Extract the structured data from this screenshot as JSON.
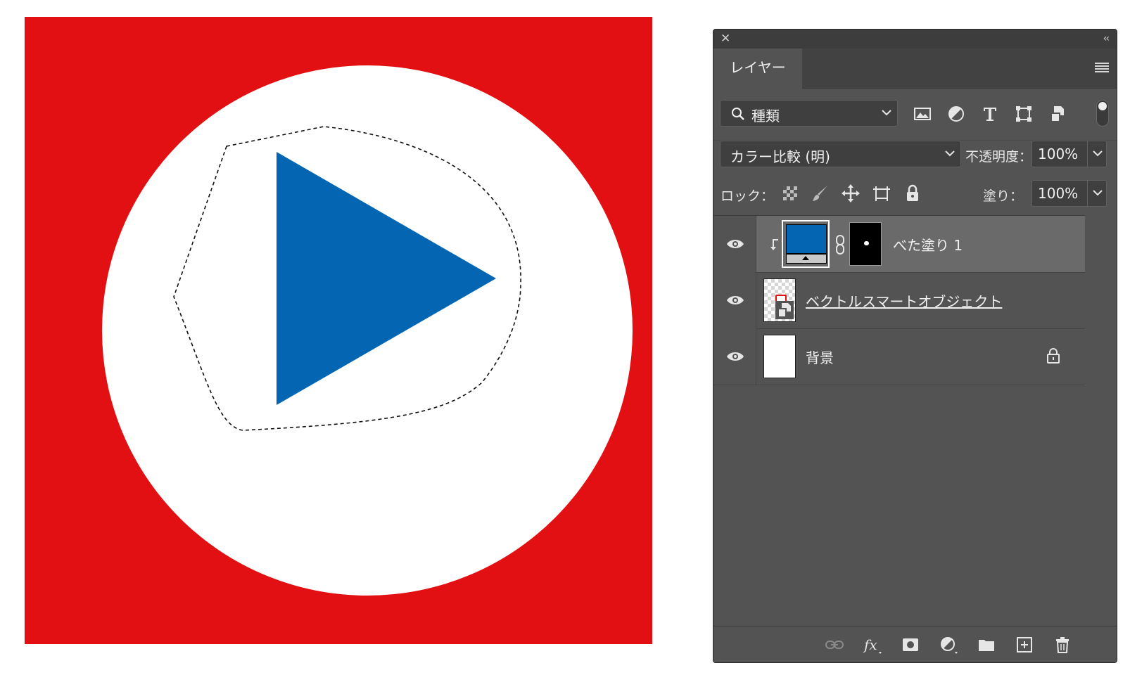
{
  "panel": {
    "tab_label": "レイヤー",
    "filter": {
      "label": "種類"
    },
    "blend": {
      "mode": "カラー比較 (明)",
      "opacity_label": "不透明度：",
      "opacity_value": "100%"
    },
    "lock": {
      "label": "ロック：",
      "fill_label": "塗り：",
      "fill_value": "100%"
    },
    "layers": [
      {
        "name": "べた塗り 1",
        "visible": true,
        "selected": true,
        "fill_color": "#0466b3"
      },
      {
        "name": "ベクトルスマートオブジェクト",
        "visible": true,
        "selected": false
      },
      {
        "name": "背景",
        "visible": true,
        "selected": false,
        "locked": true
      }
    ]
  },
  "canvas": {
    "background_color": "#e31013",
    "circle_color": "#ffffff",
    "triangle_color": "#0466b3"
  },
  "icons": {
    "close": "close-icon",
    "collapse": "collapse-icon",
    "menu": "panel-menu-icon",
    "filter": [
      "image-filter-icon",
      "adjustment-filter-icon",
      "type-filter-icon",
      "shape-filter-icon",
      "smart-object-filter-icon"
    ],
    "lock": [
      "lock-transparency-icon",
      "lock-pixels-icon",
      "lock-position-icon",
      "lock-artboard-icon",
      "lock-all-icon"
    ],
    "bottom": [
      "link-layers-icon",
      "fx-icon",
      "add-mask-icon",
      "adjustment-layer-icon",
      "new-group-icon",
      "new-layer-icon",
      "delete-icon"
    ]
  }
}
